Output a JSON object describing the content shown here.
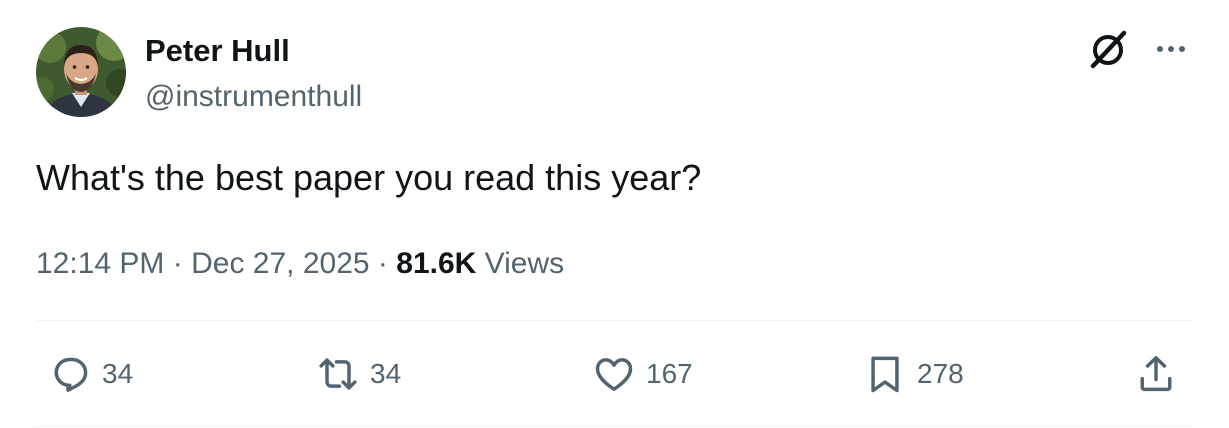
{
  "author": {
    "name": "Peter Hull",
    "handle": "@instrumenthull",
    "avatar_icon": "profile-photo"
  },
  "header_icons": [
    "grok-icon",
    "more-options-icon"
  ],
  "tweet": {
    "text": "What's the best paper you read this year?",
    "time": "12:14 PM",
    "separator": "·",
    "date": "Dec 27, 2025",
    "views_count": "81.6K",
    "views_label": "Views"
  },
  "actions": {
    "replies": "34",
    "retweets": "34",
    "likes": "167",
    "bookmarks": "278"
  },
  "colors": {
    "text": "#0f1419",
    "secondary": "#536471",
    "divider": "#eff3f4"
  }
}
